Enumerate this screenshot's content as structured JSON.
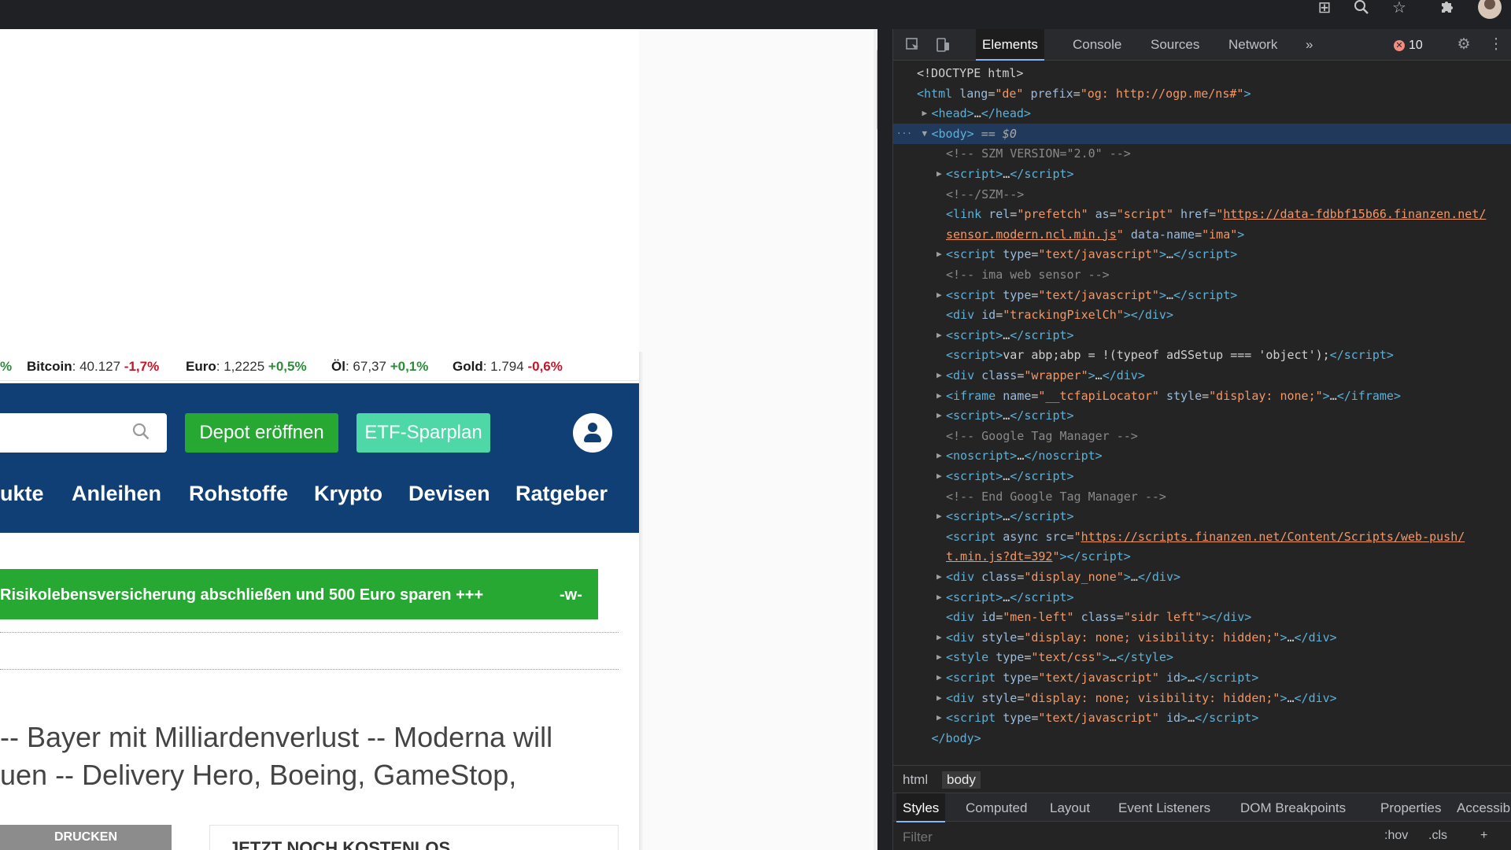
{
  "browser": {
    "icons": [
      "apps-grid-icon",
      "zoom-icon",
      "star-icon",
      "extensions-icon"
    ]
  },
  "site": {
    "ticker": [
      {
        "name": "",
        "value": "",
        "change": "%",
        "dir": "pos"
      },
      {
        "name": "Bitcoin",
        "value": "40.127",
        "change": "-1,7%",
        "dir": "neg"
      },
      {
        "name": "Euro",
        "value": "1,2225",
        "change": "+0,5%",
        "dir": "pos"
      },
      {
        "name": "Öl",
        "value": "67,37",
        "change": "+0,1%",
        "dir": "pos"
      },
      {
        "name": "Gold",
        "value": "1.794",
        "change": "-0,6%",
        "dir": "neg"
      }
    ],
    "depot_button": "Depot eröffnen",
    "etf_button": "ETF-Sparplan",
    "menu": [
      "ukte",
      "Anleihen",
      "Rohstoffe",
      "Krypto",
      "Devisen",
      "Ratgeber"
    ],
    "promo": {
      "text": "Risikolebensversicherung abschließen und 500 Euro sparen +++",
      "tag": "-w-"
    },
    "headline_lines": [
      "-- Bayer mit Milliardenverlust -- Moderna will",
      "uen -- Delivery Hero, Boeing, GameStop,"
    ],
    "print_button": "DRUCKEN",
    "kostenlos_text": "JETZT NOCH KOSTENLOS"
  },
  "devtools": {
    "tabs": [
      "Elements",
      "Console",
      "Sources",
      "Network"
    ],
    "more_tabs": "»",
    "error_count": "10",
    "dom_lines": [
      {
        "indent": 0,
        "tri": "",
        "html": "<span class='tx'>&lt;!DOCTYPE html&gt;</span>"
      },
      {
        "indent": 0,
        "tri": "",
        "html": "<span class='tag'>&lt;html</span> <span class='an'>lang</span>=<span class='av'>\"de\"</span> <span class='an'>prefix</span>=<span class='av'>\"og: http://ogp.me/ns#\"</span><span class='tag'>&gt;</span>"
      },
      {
        "indent": 1,
        "tri": "▶",
        "html": "<span class='tag'>&lt;head&gt;</span><span class='tx'>…</span><span class='tag'>&lt;/head&gt;</span>"
      },
      {
        "indent": 1,
        "tri": "▼",
        "sel": true,
        "html": "<span class='tag'>&lt;body&gt;</span> <span class='eq'>== $0</span>"
      },
      {
        "indent": 2,
        "tri": "",
        "html": "<span class='cm'>&lt;!-- SZM VERSION=\"2.0\" --&gt;</span>"
      },
      {
        "indent": 2,
        "tri": "▶",
        "html": "<span class='tag'>&lt;script&gt;</span><span class='tx'>…</span><span class='tag'>&lt;/script&gt;</span>"
      },
      {
        "indent": 2,
        "tri": "",
        "html": "<span class='cm'>&lt;!--/SZM--&gt;</span>"
      },
      {
        "indent": 2,
        "tri": "",
        "html": "<span class='tag'>&lt;link</span> <span class='an'>rel</span>=<span class='av'>\"prefetch\"</span> <span class='an'>as</span>=<span class='av'>\"script\"</span> <span class='an'>href</span>=<span class='av'>\"</span><span class='lk'>https://data-fdbbf15b66.finanzen.net/</span>"
      },
      {
        "indent": 2,
        "tri": "",
        "html": "<span class='lk'>sensor.modern.ncl.min.js</span><span class='av'>\"</span> <span class='an'>data-name</span>=<span class='av'>\"ima\"</span><span class='tag'>&gt;</span>"
      },
      {
        "indent": 2,
        "tri": "▶",
        "html": "<span class='tag'>&lt;script</span> <span class='an'>type</span>=<span class='av'>\"text/javascript\"</span><span class='tag'>&gt;</span><span class='tx'>…</span><span class='tag'>&lt;/script&gt;</span>"
      },
      {
        "indent": 2,
        "tri": "",
        "html": "<span class='cm'>&lt;!-- ima web sensor --&gt;</span>"
      },
      {
        "indent": 2,
        "tri": "▶",
        "html": "<span class='tag'>&lt;script</span> <span class='an'>type</span>=<span class='av'>\"text/javascript\"</span><span class='tag'>&gt;</span><span class='tx'>…</span><span class='tag'>&lt;/script&gt;</span>"
      },
      {
        "indent": 2,
        "tri": "",
        "html": "<span class='tag'>&lt;div</span> <span class='an'>id</span>=<span class='av'>\"trackingPixelCh\"</span><span class='tag'>&gt;&lt;/div&gt;</span>"
      },
      {
        "indent": 2,
        "tri": "▶",
        "html": "<span class='tag'>&lt;script&gt;</span><span class='tx'>…</span><span class='tag'>&lt;/script&gt;</span>"
      },
      {
        "indent": 2,
        "tri": "",
        "html": "<span class='tag'>&lt;script&gt;</span><span class='tx'>var abp;abp = !(typeof adSSetup === 'object');</span><span class='tag'>&lt;/script&gt;</span>"
      },
      {
        "indent": 2,
        "tri": "▶",
        "html": "<span class='tag'>&lt;div</span> <span class='an'>class</span>=<span class='av'>\"wrapper\"</span><span class='tag'>&gt;</span><span class='tx'>…</span><span class='tag'>&lt;/div&gt;</span>"
      },
      {
        "indent": 2,
        "tri": "▶",
        "html": "<span class='tag'>&lt;iframe</span> <span class='an'>name</span>=<span class='av'>\"__tcfapiLocator\"</span> <span class='an'>style</span>=<span class='av'>\"display: none;\"</span><span class='tag'>&gt;</span><span class='tx'>…</span><span class='tag'>&lt;/iframe&gt;</span>"
      },
      {
        "indent": 2,
        "tri": "▶",
        "html": "<span class='tag'>&lt;script&gt;</span><span class='tx'>…</span><span class='tag'>&lt;/script&gt;</span>"
      },
      {
        "indent": 2,
        "tri": "",
        "html": "<span class='cm'>&lt;!-- Google Tag Manager --&gt;</span>"
      },
      {
        "indent": 2,
        "tri": "▶",
        "html": "<span class='tag'>&lt;noscript&gt;</span><span class='tx'>…</span><span class='tag'>&lt;/noscript&gt;</span>"
      },
      {
        "indent": 2,
        "tri": "▶",
        "html": "<span class='tag'>&lt;script&gt;</span><span class='tx'>…</span><span class='tag'>&lt;/script&gt;</span>"
      },
      {
        "indent": 2,
        "tri": "",
        "html": "<span class='cm'>&lt;!-- End Google Tag Manager --&gt;</span>"
      },
      {
        "indent": 2,
        "tri": "▶",
        "html": "<span class='tag'>&lt;script&gt;</span><span class='tx'>…</span><span class='tag'>&lt;/script&gt;</span>"
      },
      {
        "indent": 2,
        "tri": "",
        "html": "<span class='tag'>&lt;script</span> <span class='an'>async</span> <span class='an'>src</span>=<span class='av'>\"</span><span class='lk'>https://scripts.finanzen.net/Content/Scripts/web-push/</span>"
      },
      {
        "indent": 2,
        "tri": "",
        "html": "<span class='lk'>t.min.js?dt=392</span><span class='av'>\"</span><span class='tag'>&gt;&lt;/script&gt;</span>"
      },
      {
        "indent": 2,
        "tri": "▶",
        "html": "<span class='tag'>&lt;div</span> <span class='an'>class</span>=<span class='av'>\"display_none\"</span><span class='tag'>&gt;</span><span class='tx'>…</span><span class='tag'>&lt;/div&gt;</span>"
      },
      {
        "indent": 2,
        "tri": "▶",
        "html": "<span class='tag'>&lt;script&gt;</span><span class='tx'>…</span><span class='tag'>&lt;/script&gt;</span>"
      },
      {
        "indent": 2,
        "tri": "",
        "html": "<span class='tag'>&lt;div</span> <span class='an'>id</span>=<span class='av'>\"men-left\"</span> <span class='an'>class</span>=<span class='av'>\"sidr left\"</span><span class='tag'>&gt;&lt;/div&gt;</span>"
      },
      {
        "indent": 2,
        "tri": "▶",
        "html": "<span class='tag'>&lt;div</span> <span class='an'>style</span>=<span class='av'>\"display: none; visibility: hidden;\"</span><span class='tag'>&gt;</span><span class='tx'>…</span><span class='tag'>&lt;/div&gt;</span>"
      },
      {
        "indent": 2,
        "tri": "▶",
        "html": "<span class='tag'>&lt;style</span> <span class='an'>type</span>=<span class='av'>\"text/css\"</span><span class='tag'>&gt;</span><span class='tx'>…</span><span class='tag'>&lt;/style&gt;</span>"
      },
      {
        "indent": 2,
        "tri": "▶",
        "html": "<span class='tag'>&lt;script</span> <span class='an'>type</span>=<span class='av'>\"text/javascript\"</span> <span class='an'>id</span><span class='tag'>&gt;</span><span class='tx'>…</span><span class='tag'>&lt;/script&gt;</span>"
      },
      {
        "indent": 2,
        "tri": "▶",
        "html": "<span class='tag'>&lt;div</span> <span class='an'>style</span>=<span class='av'>\"display: none; visibility: hidden;\"</span><span class='tag'>&gt;</span><span class='tx'>…</span><span class='tag'>&lt;/div&gt;</span>"
      },
      {
        "indent": 2,
        "tri": "▶",
        "html": "<span class='tag'>&lt;script</span> <span class='an'>type</span>=<span class='av'>\"text/javascript\"</span> <span class='an'>id</span><span class='tag'>&gt;</span><span class='tx'>…</span><span class='tag'>&lt;/script&gt;</span>"
      },
      {
        "indent": 1,
        "tri": "",
        "html": "<span class='tag'>&lt;/body&gt;</span>"
      }
    ],
    "breadcrumb": [
      "html",
      "body"
    ],
    "styles_tabs": [
      "Styles",
      "Computed",
      "Layout",
      "Event Listeners",
      "DOM Breakpoints",
      "Properties",
      "Accessibility"
    ],
    "filter_placeholder": "Filter",
    "hov_label": ":hov",
    "cls_label": ".cls",
    "add_label": "+"
  },
  "colors": {
    "nav_blue": "#0f3f75",
    "depot_green": "#27a832",
    "etf_mint": "#4ed7a7",
    "promo_green": "#27a832",
    "devtools_bg": "#242424"
  }
}
